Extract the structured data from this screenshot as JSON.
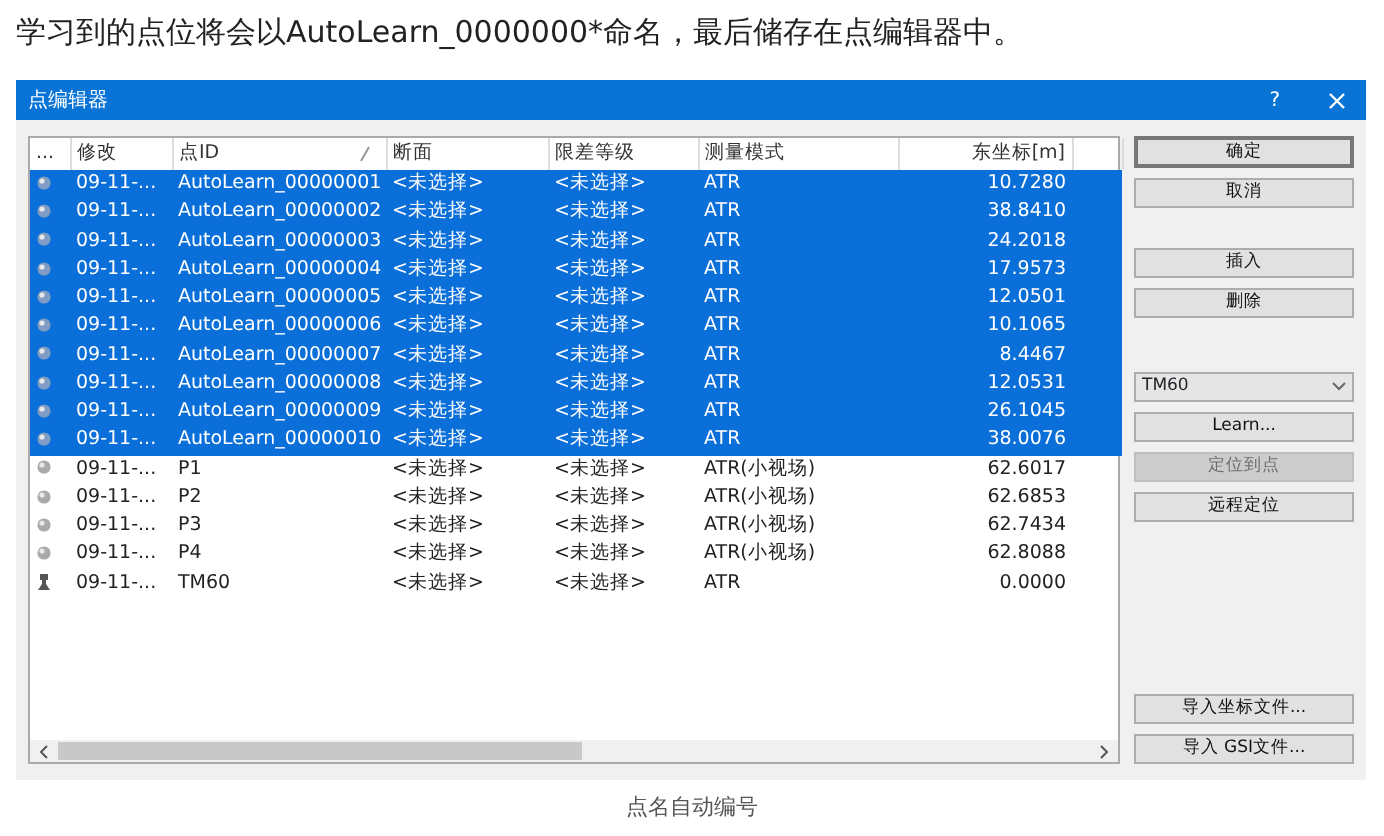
{
  "intro": "学习到的点位将会以AutoLearn_0000000*命名，最后储存在点编辑器中。",
  "dialog": {
    "title": "点编辑器",
    "help": "?",
    "table": {
      "columns": [
        "...",
        "修改",
        "点ID",
        "断面",
        "限差等级",
        "测量模式",
        "东坐标[m]"
      ],
      "rows": [
        {
          "kind": "point",
          "selected": true,
          "cells": [
            "",
            "09-11-...",
            "AutoLearn_00000001",
            "<未选择>",
            "<未选择>",
            "ATR",
            "10.7280"
          ]
        },
        {
          "kind": "point",
          "selected": true,
          "cells": [
            "",
            "09-11-...",
            "AutoLearn_00000002",
            "<未选择>",
            "<未选择>",
            "ATR",
            "38.8410"
          ]
        },
        {
          "kind": "point",
          "selected": true,
          "cells": [
            "",
            "09-11-...",
            "AutoLearn_00000003",
            "<未选择>",
            "<未选择>",
            "ATR",
            "24.2018"
          ]
        },
        {
          "kind": "point",
          "selected": true,
          "cells": [
            "",
            "09-11-...",
            "AutoLearn_00000004",
            "<未选择>",
            "<未选择>",
            "ATR",
            "17.9573"
          ]
        },
        {
          "kind": "point",
          "selected": true,
          "cells": [
            "",
            "09-11-...",
            "AutoLearn_00000005",
            "<未选择>",
            "<未选择>",
            "ATR",
            "12.0501"
          ]
        },
        {
          "kind": "point",
          "selected": true,
          "cells": [
            "",
            "09-11-...",
            "AutoLearn_00000006",
            "<未选择>",
            "<未选择>",
            "ATR",
            "10.1065"
          ]
        },
        {
          "kind": "point",
          "selected": true,
          "cells": [
            "",
            "09-11-...",
            "AutoLearn_00000007",
            "<未选择>",
            "<未选择>",
            "ATR",
            "8.4467"
          ]
        },
        {
          "kind": "point",
          "selected": true,
          "cells": [
            "",
            "09-11-...",
            "AutoLearn_00000008",
            "<未选择>",
            "<未选择>",
            "ATR",
            "12.0531"
          ]
        },
        {
          "kind": "point",
          "selected": true,
          "cells": [
            "",
            "09-11-...",
            "AutoLearn_00000009",
            "<未选择>",
            "<未选择>",
            "ATR",
            "26.1045"
          ]
        },
        {
          "kind": "point",
          "selected": true,
          "cells": [
            "",
            "09-11-...",
            "AutoLearn_00000010",
            "<未选择>",
            "<未选择>",
            "ATR",
            "38.0076"
          ]
        },
        {
          "kind": "point",
          "selected": false,
          "cells": [
            "",
            "09-11-...",
            "P1",
            "<未选择>",
            "<未选择>",
            "ATR(小视场)",
            "62.6017"
          ]
        },
        {
          "kind": "point",
          "selected": false,
          "cells": [
            "",
            "09-11-...",
            "P2",
            "<未选择>",
            "<未选择>",
            "ATR(小视场)",
            "62.6853"
          ]
        },
        {
          "kind": "point",
          "selected": false,
          "cells": [
            "",
            "09-11-...",
            "P3",
            "<未选择>",
            "<未选择>",
            "ATR(小视场)",
            "62.7434"
          ]
        },
        {
          "kind": "point",
          "selected": false,
          "cells": [
            "",
            "09-11-...",
            "P4",
            "<未选择>",
            "<未选择>",
            "ATR(小视场)",
            "62.8088"
          ]
        },
        {
          "kind": "instrument",
          "selected": false,
          "cells": [
            "",
            "09-11-...",
            "TM60",
            "<未选择>",
            "<未选择>",
            "ATR",
            "0.0000"
          ]
        }
      ]
    },
    "button_groups": [
      [
        {
          "kind": "button",
          "label": "确定",
          "default": true,
          "disabled": false
        },
        {
          "kind": "button",
          "label": "取消",
          "default": false,
          "disabled": false
        }
      ],
      [
        {
          "kind": "button",
          "label": "插入",
          "default": false,
          "disabled": false
        },
        {
          "kind": "button",
          "label": "删除",
          "default": false,
          "disabled": false
        }
      ],
      [
        {
          "kind": "select",
          "value": "TM60"
        },
        {
          "kind": "button",
          "label": "Learn...",
          "default": false,
          "disabled": false
        },
        {
          "kind": "button",
          "label": "定位到点",
          "default": false,
          "disabled": true
        },
        {
          "kind": "button",
          "label": "远程定位",
          "default": false,
          "disabled": false
        }
      ],
      [
        {
          "kind": "button",
          "label": "导入坐标文件...",
          "default": false,
          "disabled": false
        },
        {
          "kind": "button",
          "label": "导入 GSI文件...",
          "default": false,
          "disabled": false
        }
      ]
    ]
  },
  "caption": "点名自动编号"
}
